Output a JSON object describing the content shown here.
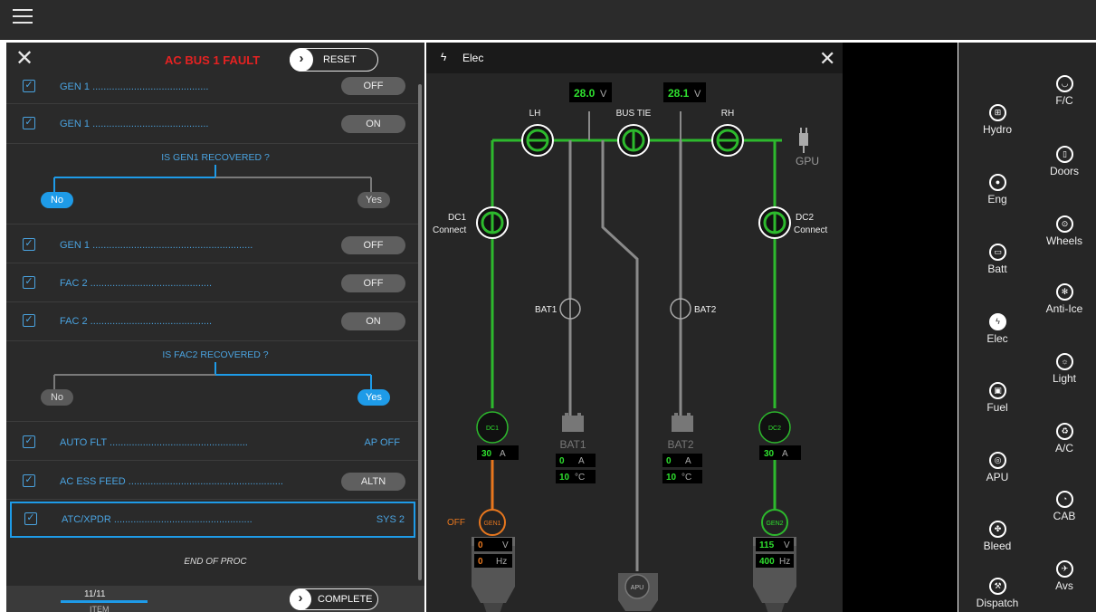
{
  "topbar": {
    "menu_icon": "hamburger-menu-icon"
  },
  "procedure": {
    "title": "AC BUS 1 FAULT",
    "reset_label": "RESET",
    "complete_label": "COMPLETE",
    "rows": [
      {
        "label": "GEN 1",
        "value": "OFF",
        "style": "pill"
      },
      {
        "label": "GEN 1",
        "value": "ON",
        "style": "pill"
      },
      {
        "label": "GEN 1",
        "value": "OFF",
        "style": "pill"
      },
      {
        "label": "FAC 2",
        "value": "OFF",
        "style": "pill"
      },
      {
        "label": "FAC 2",
        "value": "ON",
        "style": "pill"
      },
      {
        "label": "AUTO FLT",
        "value": "AP OFF",
        "style": "text"
      },
      {
        "label": "AC ESS FEED",
        "value": "ALTN",
        "style": "pill"
      },
      {
        "label": "ATC/XPDR",
        "value": "SYS 2",
        "style": "text"
      }
    ],
    "questions": [
      {
        "text": "IS GEN1 RECOVERED ?",
        "no": "No",
        "yes": "Yes"
      },
      {
        "text": "IS FAC2 RECOVERED ?",
        "no": "No",
        "yes": "Yes"
      }
    ],
    "end_text": "END OF PROC",
    "progress": {
      "label": "11/11",
      "unit": "ITEM",
      "fraction": 1.0
    }
  },
  "elec": {
    "title": "Elec",
    "bus_volts": {
      "left": "28.0",
      "right": "28.1",
      "unit": "V"
    },
    "labels": {
      "lh": "LH",
      "bus_tie": "BUS TIE",
      "rh": "RH",
      "gpu": "GPU",
      "dc1_connect_a": "DC1",
      "dc1_connect_b": "Connect",
      "dc2_connect_a": "DC2",
      "dc2_connect_b": "Connect",
      "bat1": "BAT1",
      "bat2": "BAT2",
      "dc1": "DC1",
      "dc2": "DC2",
      "gen1": "GEN1",
      "gen2": "GEN2",
      "apu": "APU",
      "off": "OFF"
    },
    "dc1_amps": {
      "value": "30",
      "unit": "A"
    },
    "dc2_amps": {
      "value": "30",
      "unit": "A"
    },
    "bat1": {
      "name": "BAT1",
      "amps": "0",
      "amps_unit": "A",
      "temp": "10",
      "temp_unit": "°C"
    },
    "bat2": {
      "name": "BAT2",
      "amps": "0",
      "amps_unit": "A",
      "temp": "10",
      "temp_unit": "°C"
    },
    "gen1": {
      "volts": "0",
      "volts_unit": "V",
      "freq": "0",
      "freq_unit": "Hz"
    },
    "gen2": {
      "volts": "115",
      "volts_unit": "V",
      "freq": "400",
      "freq_unit": "Hz"
    },
    "colors": {
      "green": "#2db92d",
      "orange": "#e8771e",
      "grey": "#8a8a8a",
      "value_green": "#2fe02f"
    }
  },
  "systems_nav": {
    "col1": [
      {
        "label": "Hydro",
        "icon": "hydraulics-icon",
        "active": false
      },
      {
        "label": "Eng",
        "icon": "engine-icon",
        "active": false
      },
      {
        "label": "Batt",
        "icon": "battery-icon",
        "active": false
      },
      {
        "label": "Elec",
        "icon": "lightning-icon",
        "active": true
      },
      {
        "label": "Fuel",
        "icon": "fuel-icon",
        "active": false
      },
      {
        "label": "APU",
        "icon": "apu-icon",
        "active": false
      },
      {
        "label": "Bleed",
        "icon": "fan-icon",
        "active": false
      },
      {
        "label": "Dispatch",
        "icon": "wrench-icon",
        "active": false
      }
    ],
    "col2": [
      {
        "label": "F/C",
        "icon": "flight-controls-icon",
        "active": false
      },
      {
        "label": "Doors",
        "icon": "door-icon",
        "active": false
      },
      {
        "label": "Wheels",
        "icon": "wheel-icon",
        "active": false
      },
      {
        "label": "Anti-Ice",
        "icon": "snowflake-icon",
        "active": false
      },
      {
        "label": "Light",
        "icon": "light-icon",
        "active": false
      },
      {
        "label": "A/C",
        "icon": "air-conditioning-icon",
        "active": false
      },
      {
        "label": "CAB",
        "icon": "cabin-icon",
        "active": false
      },
      {
        "label": "Avs",
        "icon": "airplane-icon",
        "active": false
      }
    ]
  }
}
